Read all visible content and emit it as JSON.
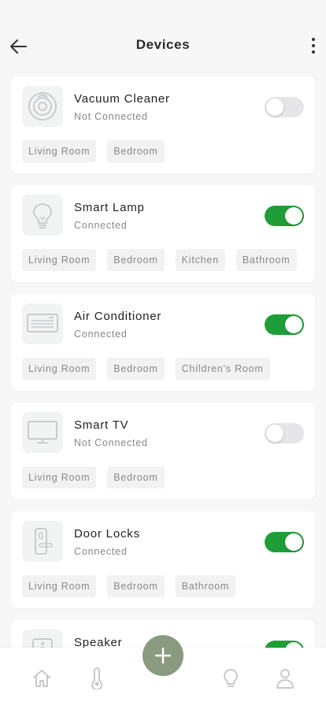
{
  "header": {
    "title": "Devices"
  },
  "colors": {
    "accent_green": "#1f9e37",
    "fab": "#8a9a7e",
    "background": "#f7f7f7"
  },
  "devices": [
    {
      "name": "Vacuum Cleaner",
      "status": "Not Connected",
      "on": false,
      "icon": "vacuum-icon",
      "rooms": [
        "Living Room",
        "Bedroom"
      ]
    },
    {
      "name": "Smart Lamp",
      "status": "Connected",
      "on": true,
      "icon": "lamp-icon",
      "rooms": [
        "Living Room",
        "Bedroom",
        "Kitchen",
        "Bathroom"
      ]
    },
    {
      "name": "Air Conditioner",
      "status": "Connected",
      "on": true,
      "icon": "air-conditioner-icon",
      "rooms": [
        "Living Room",
        "Bedroom",
        "Children's Room"
      ]
    },
    {
      "name": "Smart TV",
      "status": "Not Connected",
      "on": false,
      "icon": "tv-icon",
      "rooms": [
        "Living Room",
        "Bedroom"
      ]
    },
    {
      "name": "Door Locks",
      "status": "Connected",
      "on": true,
      "icon": "door-lock-icon",
      "rooms": [
        "Living Room",
        "Bedroom",
        "Bathroom"
      ]
    },
    {
      "name": "Speaker",
      "status": "",
      "on": true,
      "icon": "speaker-icon",
      "rooms": []
    }
  ],
  "tabbar": {
    "items": [
      "home-icon",
      "thermometer-icon",
      "add-icon",
      "lightbulb-icon",
      "profile-icon"
    ]
  }
}
